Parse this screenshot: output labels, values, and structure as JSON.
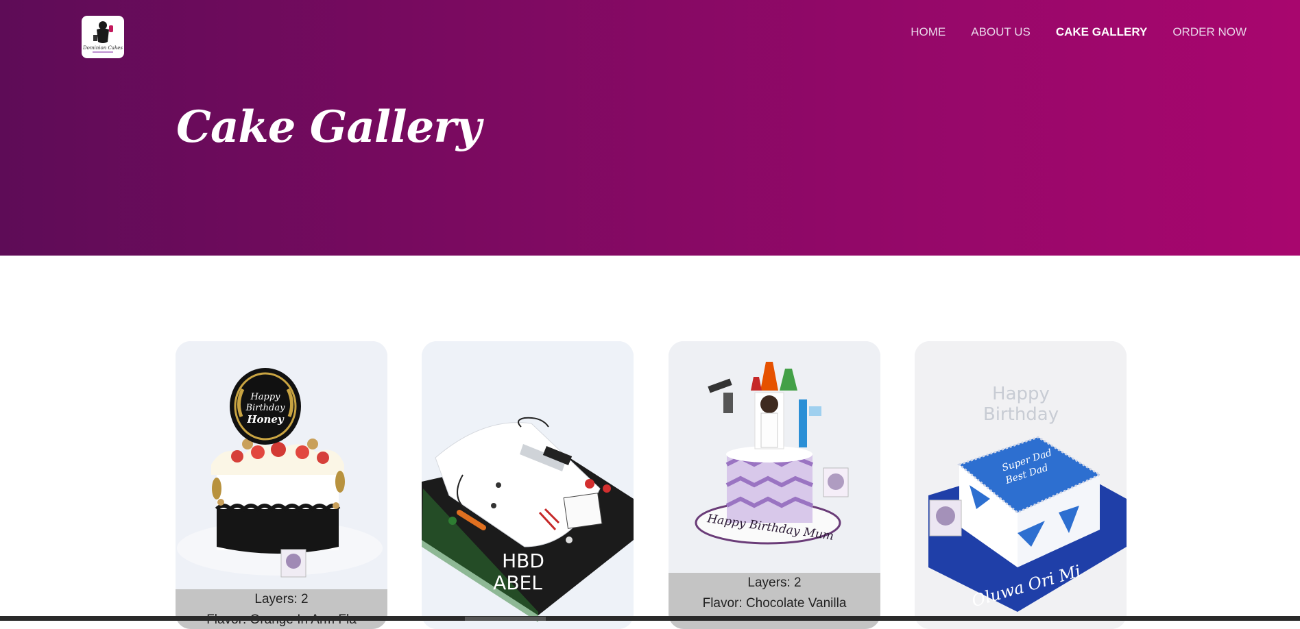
{
  "brand": {
    "logo_icon": "dominion-cakes-logo-icon",
    "logo_text": "Dominion Cakes"
  },
  "nav": {
    "items": [
      {
        "label": "HOME",
        "active": false
      },
      {
        "label": "ABOUT US",
        "active": false
      },
      {
        "label": "CAKE GALLERY",
        "active": true
      },
      {
        "label": "ORDER NOW",
        "active": false
      }
    ]
  },
  "hero": {
    "title": "Cake Gallery"
  },
  "gallery": {
    "cards": [
      {
        "image": "birthday-honey-cake-photo",
        "layers": "Layers: 2",
        "flavor": "Flavor: Orange In Arm Fla"
      },
      {
        "image": "hbd-abel-chef-coat-cake-photo",
        "layers": "",
        "flavor": ""
      },
      {
        "image": "science-lab-mum-cake-photo",
        "layers": "Layers: 2",
        "flavor": "Flavor: Chocolate Vanilla"
      },
      {
        "image": "super-dad-blue-square-cake-photo",
        "layers": "",
        "flavor": ""
      }
    ]
  },
  "colors": {
    "hero_start": "#5e0c57",
    "hero_end": "#a8066e",
    "caption_bg": "#c4c4c4"
  }
}
